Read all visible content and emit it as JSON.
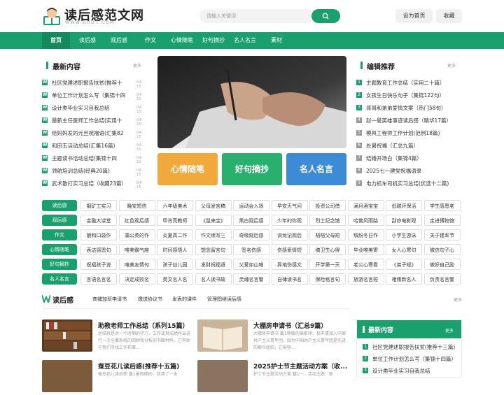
{
  "header": {
    "logo_title": "读后感范文网",
    "logo_sub": "WWW.DHD7.COM",
    "search_placeholder": "请输入关键词",
    "set_home": "设为首页",
    "favorite": "收藏"
  },
  "nav": [
    "首页",
    "读后感",
    "观后感",
    "作文",
    "心情随笔",
    "好句摘抄",
    "名人名言",
    "素材"
  ],
  "latest": {
    "title": "最新内容",
    "more": "更多",
    "items": [
      {
        "t": "社区党建述职报告扶贫(推荐十",
        "d": "04-15"
      },
      {
        "t": "单位工作计划怎么写（集锦十四",
        "d": "04-15"
      },
      {
        "t": "设计类毕业实习自我总结",
        "d": "04-15"
      },
      {
        "t": "最新主任医师工作总结(实用十",
        "d": "04-15"
      },
      {
        "t": "给妈妈发的元旦祝福语(汇集82",
        "d": "04-15"
      },
      {
        "t": "和田玉活动总结(汇集16篇)",
        "d": "04-15"
      },
      {
        "t": "主题读书活动总结(集锦十四",
        "d": "04-15"
      },
      {
        "t": "领航培训总结(经典20篇)",
        "d": "04-15"
      },
      {
        "t": "武术散打实习总结（收藏23篇）",
        "d": "04-15"
      }
    ]
  },
  "tiles": [
    "心情随笔",
    "好句摘抄",
    "名人名言"
  ],
  "editor": {
    "title": "编辑推荐",
    "more": "更多",
    "items": [
      "主题教育工作总结（实用二十篇）",
      "女孩生日快乐句子（集锦122句）",
      "哥哥和弟弟爱情文案（热门58句）",
      "赵一曼英雄事迹读后感（精华17篇）",
      "模具工程师工作计划(范例18篇)",
      "处暑祝福（汇总九篇）",
      "结婚开场白（集锦4篇）",
      "2025七一建党祝福语录",
      "电力机车司机实习总结(优选十二篇)"
    ],
    "colors": [
      "#1aa06d",
      "#1aa06d",
      "#1aa06d",
      "#999",
      "#999",
      "#999",
      "#999",
      "#999",
      "#999"
    ]
  },
  "cats": [
    {
      "h": "读后感",
      "tags": [
        "钢矿工实习",
        "晚安短信",
        "六年级美术",
        "父母发言稿",
        "运动会入场",
        "早安天气问",
        "投资公司借",
        "满月酒宝宝",
        "低碳环保活",
        "学生感恩老"
      ]
    },
    {
      "h": "观后感",
      "tags": [
        "金融大讲堂",
        "红色观后感",
        "甲肖亮教师",
        "《鼠来宝》",
        "黑白观后感",
        "少年的你观",
        "烈士纪念馆",
        "哈佛风雨路",
        "刮痧电影观",
        "走进博物馆"
      ]
    },
    {
      "h": "作文",
      "tags": [
        "狼和口袋作",
        "蒲公英的作",
        "炎夏高二作",
        "作文续写三",
        "奇缘观后感",
        "训龙记观后",
        "陪陪父母短",
        "缤纷冬日作",
        "小学生游泳",
        "关于建军节"
      ]
    },
    {
      "h": "心情随笔",
      "tags": [
        "表达感恩句",
        "唯美霸气座",
        "时间感悟人",
        "想念留言句",
        "签名伤感",
        "伤感爱情短",
        "搞卫生心得",
        "毕业唯美寄",
        "女人心寒句",
        "微信句子心"
      ]
    },
    {
      "h": "好句摘抄",
      "tags": [
        "祝福孩子说",
        "唯美友情句",
        "孩子幼儿园",
        "发财祝福语",
        "父爱如山唯",
        "异地伤感文",
        "开学第一天",
        "老公心寒看",
        "《弟子规》",
        "做好自己励"
      ]
    },
    {
      "h": "名人名言",
      "tags": [
        "言语名言名",
        "决定成败名",
        "英文名人名",
        "名人读书故",
        "灵魂名言警",
        "自律读书名",
        "保险格言句",
        "旅游名言短",
        "褚儒新名人",
        "负责名言警"
      ]
    }
  ],
  "section": {
    "title": "读后感",
    "links": [
      "商铺加班申请书",
      "缴送协议书",
      "发表的课件",
      "管理图继读后感"
    ],
    "more": "更多"
  },
  "articles": [
    {
      "t": "助教老师工作总结（系列15篇）",
      "d": "总结就是对一个时期的学习、工作或其成绩作出进行一次全面系统的回顾和分析的书面材料，它有助于我们寻找工作和事..."
    },
    {
      "t": "大棚房申请书（汇总9篇）",
      "d": "大棚房申请书 篇1尊敬的国家领：我申请加入中国共产主义青年团。因为中国共产主义青年团是先进的群众组织，它能够..."
    },
    {
      "t": "蚕豆花儿读后感(推荐十五篇)",
      "d": "蚕豆花儿读后感 篇1暑假期间，我读了一本"
    },
    {
      "t": "2025护士节主题活动方案（收...",
      "d": "护士节主题活动方案 篇1一、活动主题：致"
    }
  ],
  "side_latest": {
    "title": "最新内容",
    "more": "更多",
    "items": [
      "社区党建述职报告扶贫(推荐十三篇)",
      "单位工作计划怎么写（集锦十四篇）",
      "设计类毕业实习自我总结"
    ]
  }
}
